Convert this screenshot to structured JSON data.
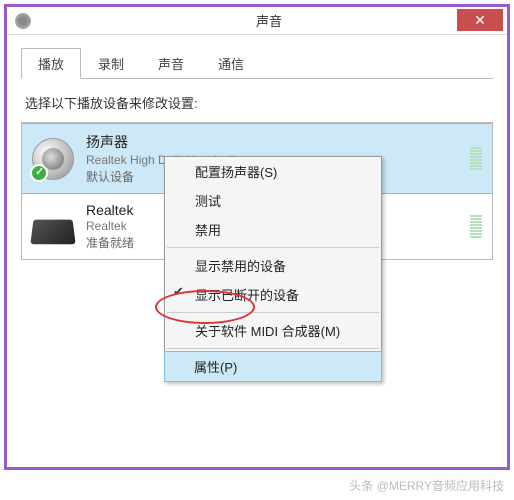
{
  "window": {
    "title": "声音",
    "close": "✕"
  },
  "tabs": [
    "播放",
    "录制",
    "声音",
    "通信"
  ],
  "instruction": "选择以下播放设备来修改设置:",
  "devices": [
    {
      "name": "扬声器",
      "desc": "Realtek High Definition Audio",
      "status": "默认设备"
    },
    {
      "name": "Realtek",
      "desc": "Realtek",
      "status": "准备就绪"
    }
  ],
  "menu": {
    "configure": "配置扬声器(S)",
    "test": "测试",
    "disable": "禁用",
    "show_disabled": "显示禁用的设备",
    "show_disconnected": "显示已断开的设备",
    "about_midi": "关于软件 MIDI 合成器(M)",
    "properties": "属性(P)"
  },
  "watermark": "头条 @MERRY音频应用科技"
}
